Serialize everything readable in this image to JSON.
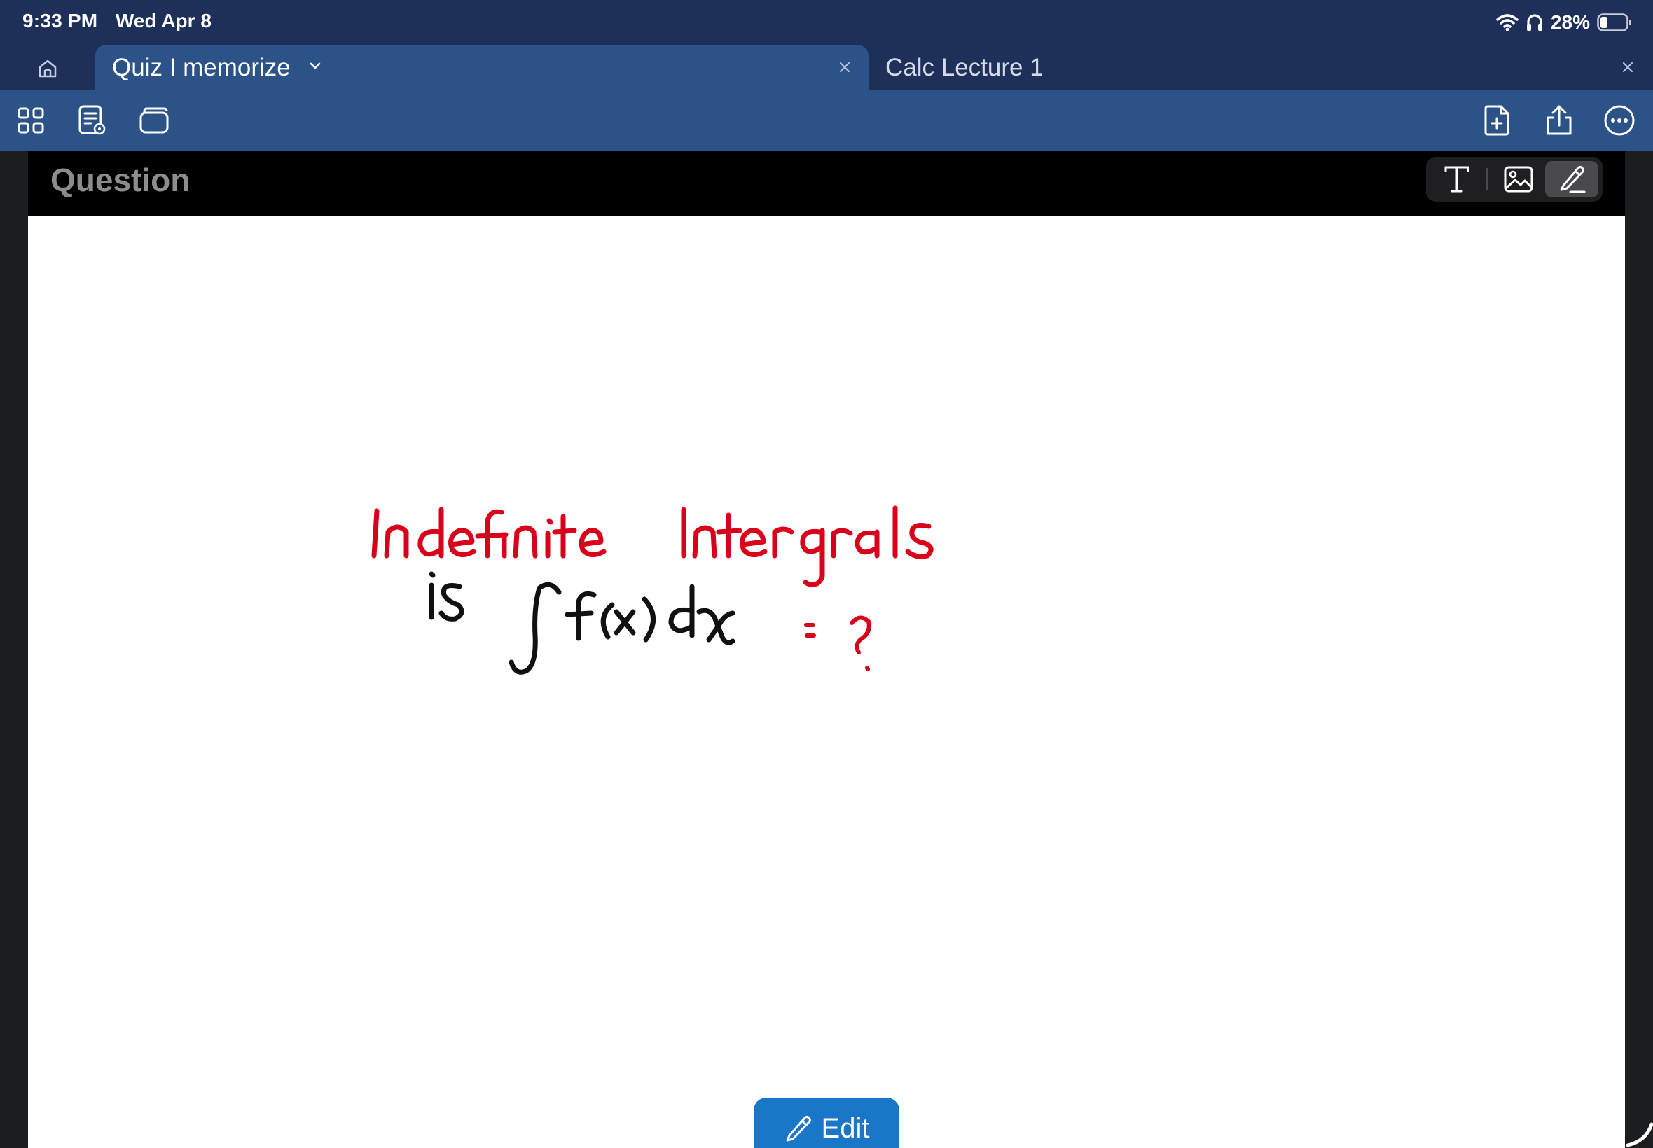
{
  "status_bar": {
    "time": "9:33 PM",
    "date": "Wed Apr 8",
    "battery_percent": "28%",
    "battery_level": 0.28,
    "icons": [
      "wifi-icon",
      "headphones-icon",
      "battery-icon"
    ]
  },
  "tabs": [
    {
      "label": "Quiz I memorize",
      "active": true
    },
    {
      "label": "Calc Lecture 1",
      "active": false
    }
  ],
  "toolbar": {
    "left_icons": [
      "grid-icon",
      "document-preview-icon",
      "stack-icon"
    ],
    "right_icons": [
      "new-page-icon",
      "share-icon",
      "more-icon"
    ]
  },
  "card": {
    "title": "Question",
    "input_modes": [
      "text-mode-icon",
      "image-mode-icon",
      "pen-mode-icon"
    ],
    "active_mode": "pen",
    "handwriting_lines": [
      "Indefinite Intergrals",
      "is ∫f(x) dx = ?"
    ]
  },
  "edit_button": {
    "label": "Edit"
  },
  "colors": {
    "status_bar": "#1e2f5a",
    "toolbar": "#2c5387",
    "ink_red": "#d9001b",
    "ink_black": "#111111",
    "edit_button": "#1a76c9"
  }
}
